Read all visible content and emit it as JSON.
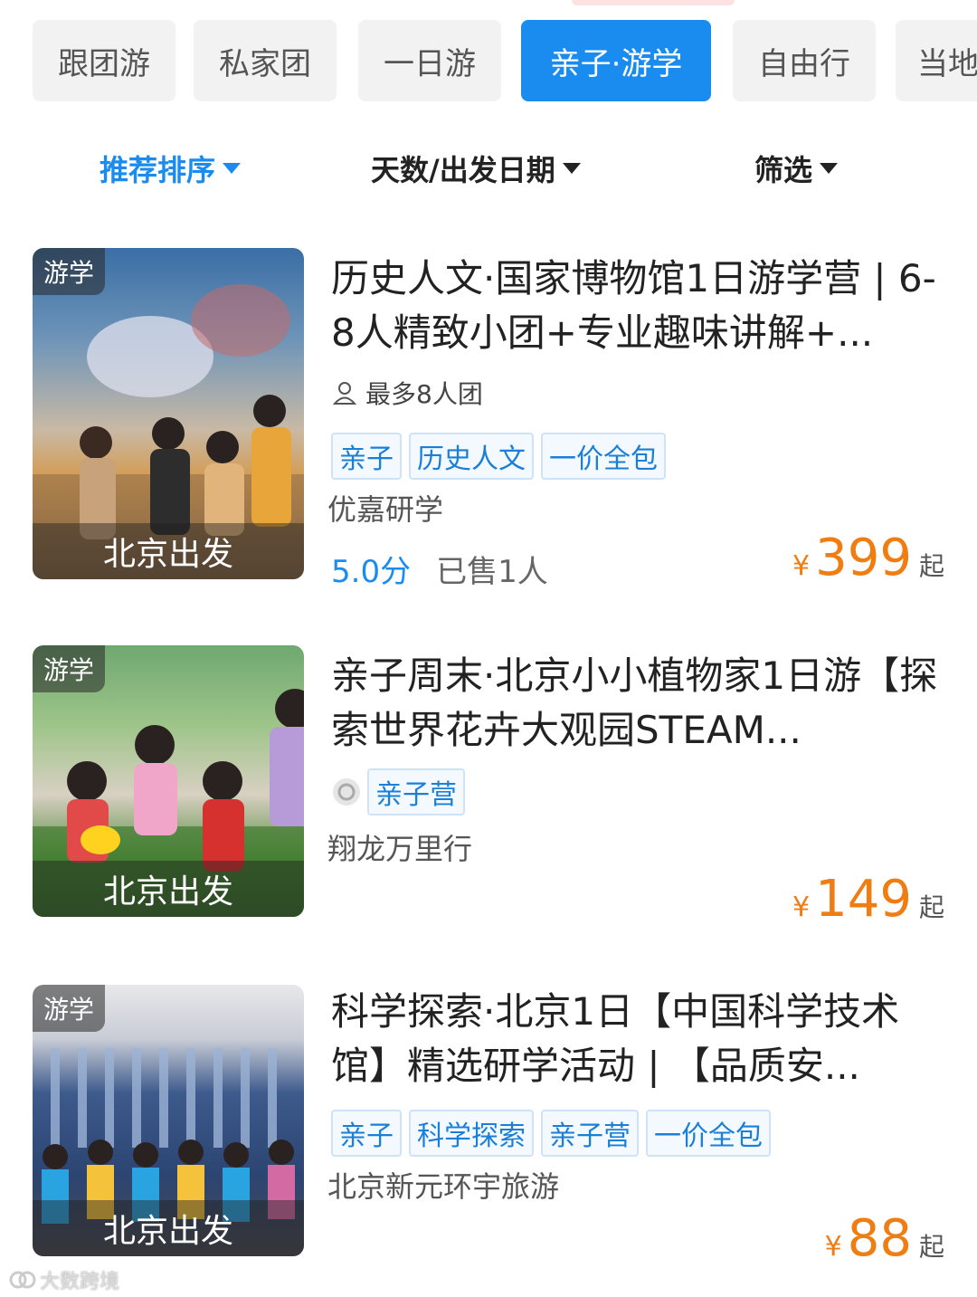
{
  "tabs": [
    {
      "label": "跟团游",
      "active": false
    },
    {
      "label": "私家团",
      "active": false
    },
    {
      "label": "一日游",
      "active": false
    },
    {
      "label": "亲子·游学",
      "active": true
    },
    {
      "label": "自由行",
      "active": false
    },
    {
      "label": "当地",
      "active": false
    }
  ],
  "sort": {
    "recommend": "推荐排序",
    "days_date": "天数/出发日期",
    "filter": "筛选"
  },
  "products": [
    {
      "badge": "游学",
      "departure": "北京出发",
      "title": "历史人文·国家博物馆1日游学营 | 6-8人精致小团+专业趣味讲解+...",
      "group_size": "最多8人团",
      "tags": [
        "亲子",
        "历史人文",
        "一价全包"
      ],
      "merchant": "优嘉研学",
      "score": "5.0分",
      "sold": "已售1人",
      "currency": "¥",
      "price": "399",
      "price_suffix": "起"
    },
    {
      "badge": "游学",
      "departure": "北京出发",
      "title": "亲子周末·北京小小植物家1日游【探索世界花卉大观园STEAM...",
      "tags": [
        "亲子营"
      ],
      "merchant": "翔龙万里行",
      "currency": "¥",
      "price": "149",
      "price_suffix": "起"
    },
    {
      "badge": "游学",
      "departure": "北京出发",
      "title": "科学探索·北京1日【中国科学技术馆】精选研学活动 | 【品质安...",
      "tags": [
        "亲子",
        "科学探索",
        "亲子营",
        "一价全包"
      ],
      "merchant": "北京新元环宇旅游",
      "currency": "¥",
      "price": "88",
      "price_suffix": "起"
    }
  ],
  "watermark": "大数跨境",
  "colors": {
    "accent": "#1a8cf0",
    "price": "#f07d12"
  }
}
